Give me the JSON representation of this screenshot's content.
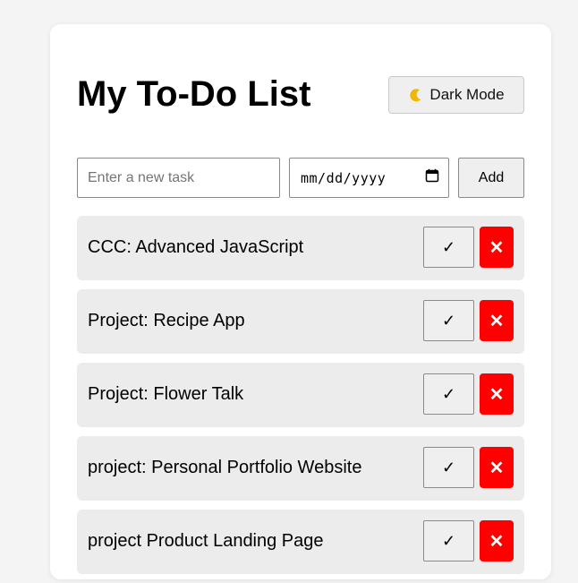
{
  "app": {
    "title": "My To-Do List",
    "dark_mode_label": "Dark Mode",
    "dark_mode_icon": "crescent-moon-icon"
  },
  "form": {
    "task_placeholder": "Enter a new task",
    "task_value": "",
    "date_placeholder": "mm/dd/yyyy",
    "add_label": "Add"
  },
  "tasks": [
    {
      "text": "CCC: Advanced JavaScript",
      "complete_label": "✓",
      "delete_label": "✕"
    },
    {
      "text": "Project: Recipe App",
      "complete_label": "✓",
      "delete_label": "✕"
    },
    {
      "text": "Project: Flower Talk",
      "complete_label": "✓",
      "delete_label": "✕"
    },
    {
      "text": "project: Personal Portfolio Website",
      "complete_label": "✓",
      "delete_label": "✕"
    },
    {
      "text": "project Product Landing Page",
      "complete_label": "✓",
      "delete_label": "✕"
    }
  ],
  "colors": {
    "delete_button": "#ff0000",
    "item_background": "#ececec",
    "page_background": "#f4f4f4"
  }
}
